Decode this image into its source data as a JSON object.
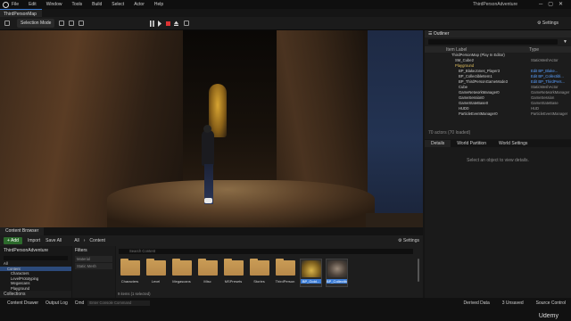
{
  "window": {
    "title": "ThirdPersonAdventure",
    "menu": [
      "File",
      "Edit",
      "Window",
      "Tools",
      "Build",
      "Select",
      "Actor",
      "Help"
    ]
  },
  "level_tab": "ThirdPersonMap",
  "toolbar": {
    "mode": "Selection Mode",
    "settings": "Settings"
  },
  "outliner": {
    "title": "Outliner",
    "col_label": "Item Label",
    "col_type": "Type",
    "items": [
      {
        "label": "ThirdPersonMap (Play In Editor)",
        "type": "",
        "folder": false,
        "link": false
      },
      {
        "label": "SM_Cube2",
        "type": "StaticMeshActor",
        "folder": false,
        "link": false
      },
      {
        "label": "Playground",
        "type": "",
        "folder": true,
        "link": false
      },
      {
        "label": "BP_BlakeJones_Player3",
        "type": "Edit BP_Blake...",
        "folder": false,
        "link": true
      },
      {
        "label": "BP_CollectibleItem1",
        "type": "Edit BP_Collectibl...",
        "folder": false,
        "link": true
      },
      {
        "label": "BP_ThirdPersonGameMode3",
        "type": "Edit BP_ThirdPers...",
        "folder": false,
        "link": true
      },
      {
        "label": "Cube",
        "type": "StaticMeshActor",
        "folder": false,
        "link": false
      },
      {
        "label": "GameNetworkManager0",
        "type": "GameNetworkManager",
        "folder": false,
        "link": false
      },
      {
        "label": "GameSession0",
        "type": "GameSession",
        "folder": false,
        "link": false
      },
      {
        "label": "GameStateBase0",
        "type": "GameStateBase",
        "folder": false,
        "link": false
      },
      {
        "label": "HUD0",
        "type": "HUD",
        "folder": false,
        "link": false
      },
      {
        "label": "ParticleEventManager0",
        "type": "ParticleEventManager",
        "folder": false,
        "link": false
      }
    ],
    "footer": "70 actors (70 loaded)"
  },
  "details": {
    "tabs": [
      "Details",
      "World Partition",
      "World Settings"
    ],
    "empty_message": "Select an object to view details."
  },
  "content_browser": {
    "tab": "Content Browser",
    "add": "+ Add",
    "import": "Import",
    "save_all": "Save All",
    "breadcrumb": [
      "All",
      "Content"
    ],
    "settings": "Settings",
    "tree_root": "ThirdPersonAdventure",
    "tree": [
      "All",
      "Content",
      "Characters",
      "LevelPrototyping",
      "Megascans",
      "Playground"
    ],
    "collections": "Collections",
    "filters_title": "Filters",
    "filters": [
      "Material",
      "Static Mesh"
    ],
    "search_placeholder": "Search Content",
    "folders": [
      "Characters",
      "Level",
      "Megascans",
      "Misc",
      "MSPresets",
      "Stories",
      "ThirdPerson"
    ],
    "assets": [
      "BP_Gold...",
      "BP_Collectible"
    ],
    "selection_count": "9 items (1 selected)"
  },
  "status": {
    "content_drawer": "Content Drawer",
    "output_log": "Output Log",
    "cmd": "Cmd",
    "cmd_placeholder": "Enter Console Command",
    "derived_data": "Derived Data",
    "unsaved": "3 Unsaved",
    "source_control": "Source Control",
    "watermark": "Udemy"
  },
  "colors": {
    "accent": "#3a7bd5",
    "folder": "#c89b55",
    "add_button": "#2c6a2c"
  }
}
